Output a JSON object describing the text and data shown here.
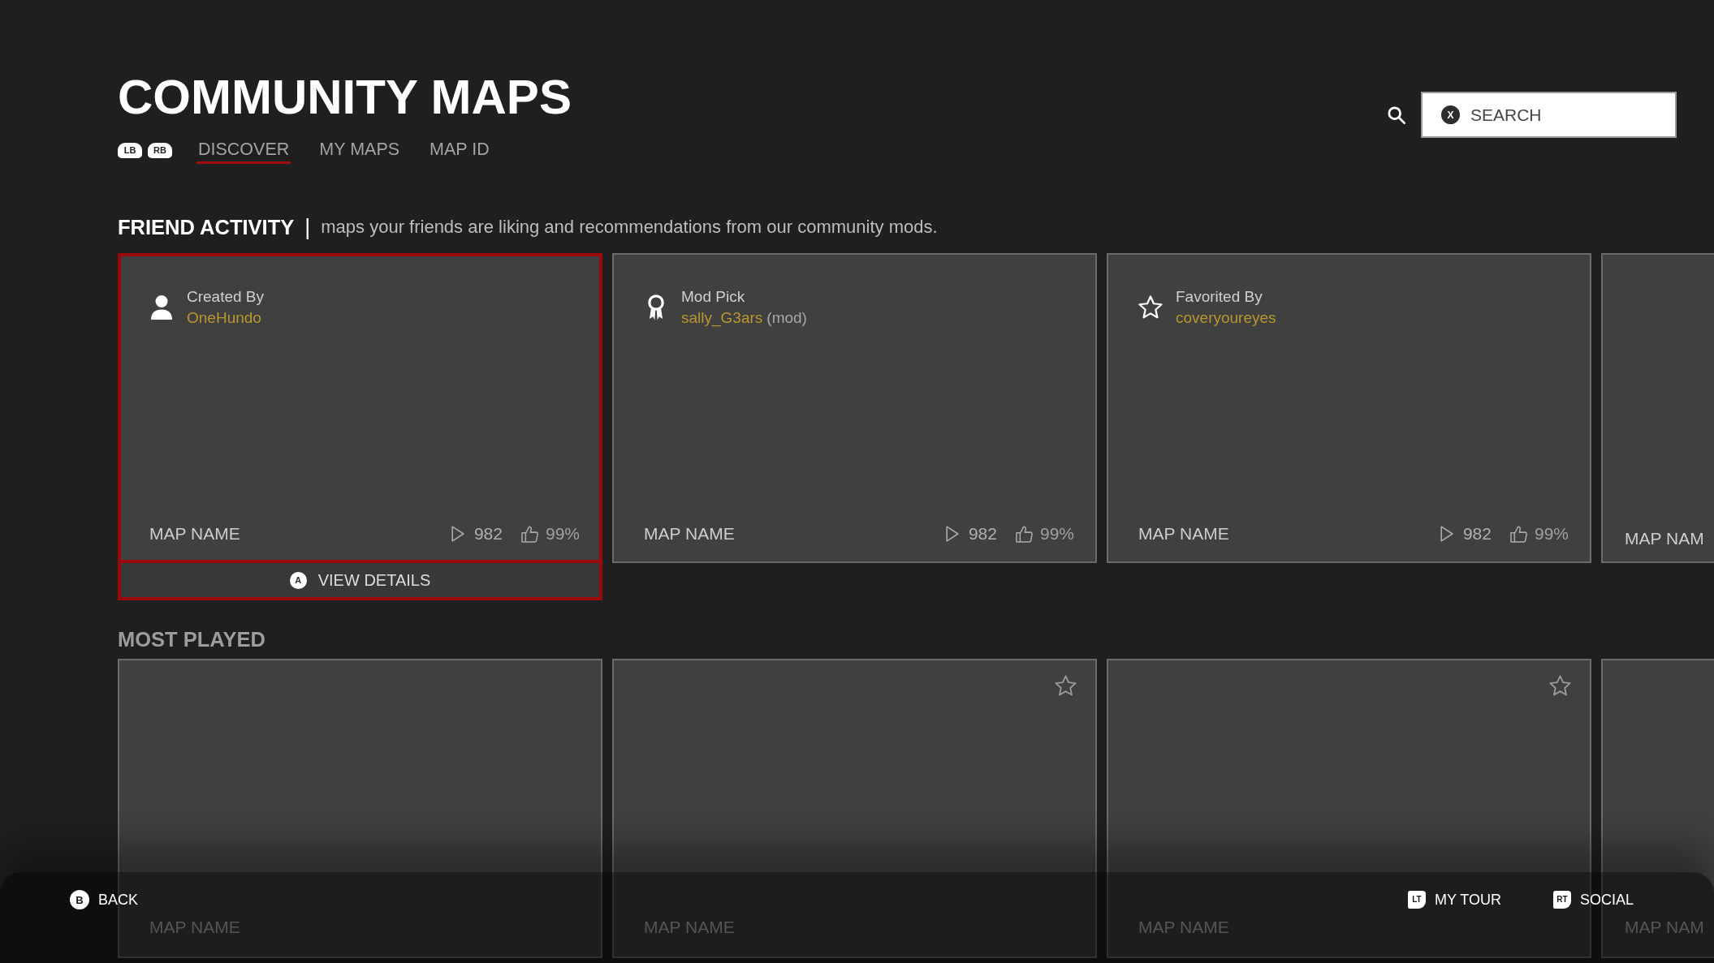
{
  "header": {
    "title": "COMMUNITY MAPS",
    "bumpers": [
      "LB",
      "RB"
    ],
    "tabs": [
      {
        "label": "DISCOVER",
        "selected": true
      },
      {
        "label": "MY MAPS",
        "selected": false
      },
      {
        "label": "MAP ID",
        "selected": false
      }
    ],
    "search": {
      "key": "X",
      "placeholder": "SEARCH"
    }
  },
  "friend_activity": {
    "title": "FRIEND ACTIVITY",
    "separator": "|",
    "description": "maps your friends are liking and recommendations from our community mods.",
    "cards": [
      {
        "kind": "created",
        "label": "Created By",
        "user": "OneHundo",
        "map_name": "MAP NAME",
        "plays": "982",
        "rating": "99%",
        "selected": true,
        "action": {
          "key": "A",
          "label": "VIEW DETAILS"
        }
      },
      {
        "kind": "mod_pick",
        "label": "Mod Pick",
        "user": "sally_G3ars",
        "note": "(mod)",
        "map_name": "MAP NAME",
        "plays": "982",
        "rating": "99%",
        "selected": false
      },
      {
        "kind": "favorited",
        "label": "Favorited By",
        "user": "coveryoureyes",
        "map_name": "MAP NAME",
        "plays": "982",
        "rating": "99%",
        "selected": false
      },
      {
        "map_name": "MAP NAM",
        "selected": false
      }
    ]
  },
  "most_played": {
    "title": "MOST PLAYED",
    "cards": [
      {
        "map_name": "MAP NAME",
        "star": false
      },
      {
        "map_name": "MAP NAME",
        "star": true
      },
      {
        "map_name": "MAP NAME",
        "star": true
      },
      {
        "map_name": "MAP NAM",
        "star": false
      }
    ]
  },
  "footer": [
    {
      "kind": "button",
      "key": "B",
      "label": "BACK"
    },
    {
      "kind": "trigger",
      "key": "LT",
      "label": "MY TOUR"
    },
    {
      "kind": "trigger",
      "key": "RT",
      "label": "SOCIAL"
    }
  ]
}
